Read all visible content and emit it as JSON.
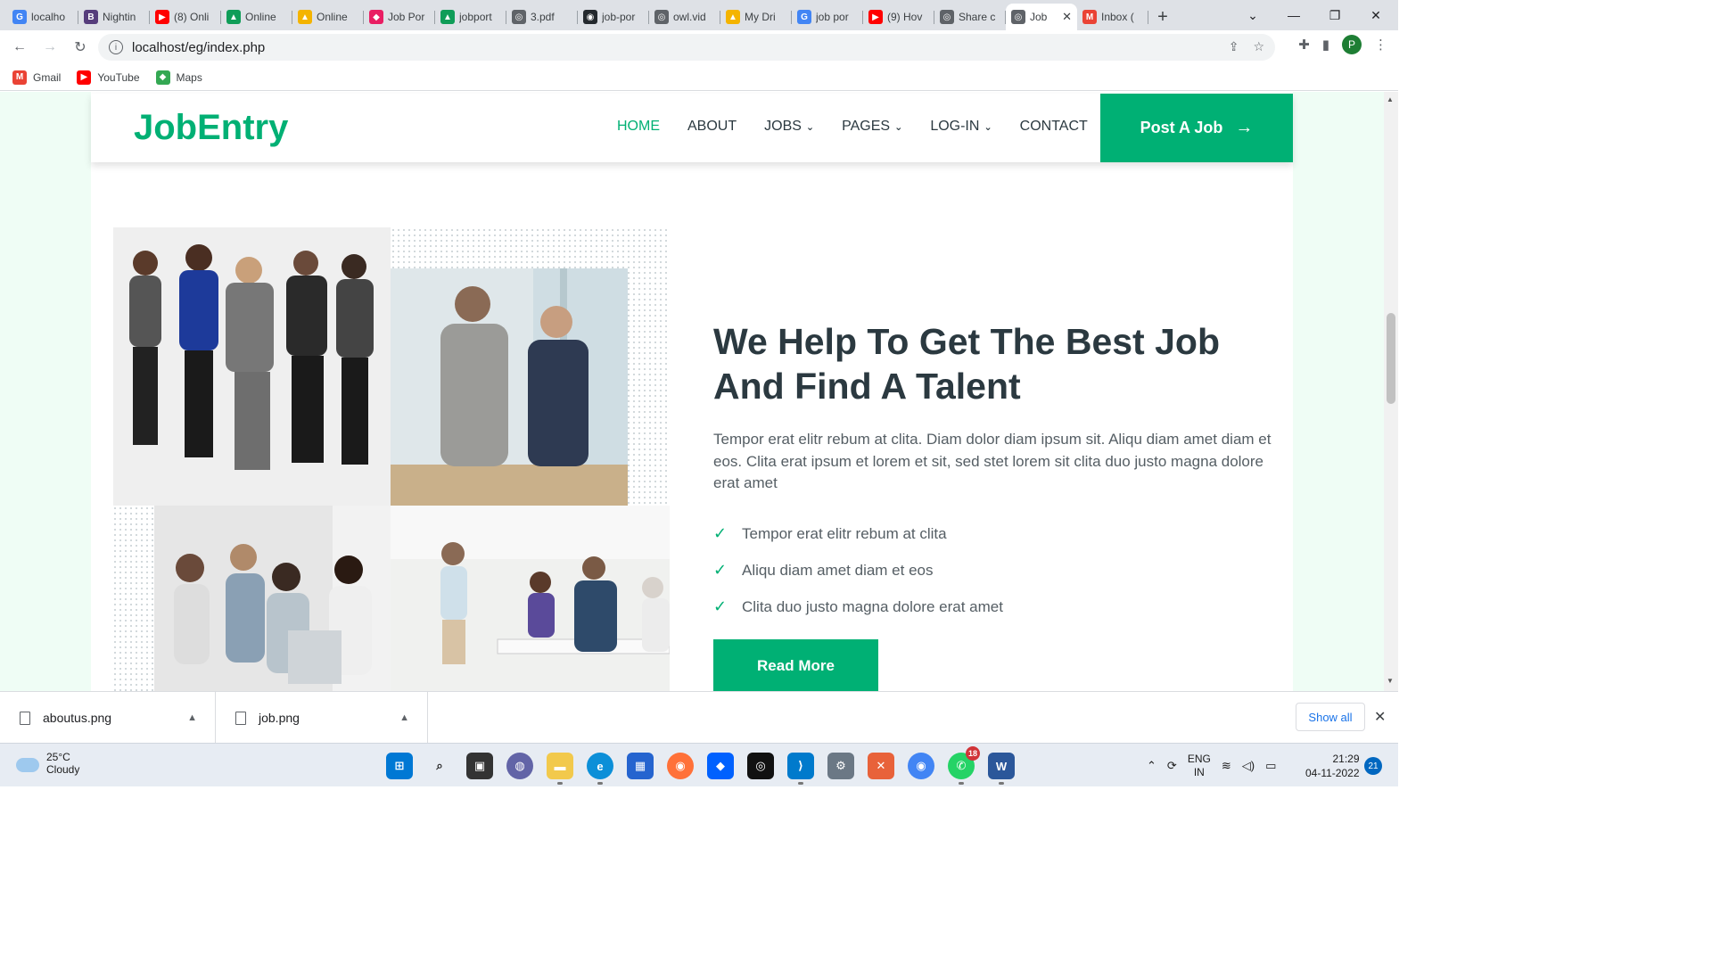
{
  "browser": {
    "tabs": [
      {
        "label": "localho",
        "favicon": "G",
        "color": "#4285f4"
      },
      {
        "label": "Nightin",
        "favicon": "B",
        "color": "#563d7c"
      },
      {
        "label": "(8) Onli",
        "favicon": "▶",
        "color": "#ff0000"
      },
      {
        "label": "Online",
        "favicon": "▲",
        "color": "#0f9d58"
      },
      {
        "label": "Online",
        "favicon": "▲",
        "color": "#f4b400"
      },
      {
        "label": "Job Por",
        "favicon": "◆",
        "color": "#e91e63"
      },
      {
        "label": "jobport",
        "favicon": "▲",
        "color": "#0f9d58"
      },
      {
        "label": "3.pdf",
        "favicon": "◎",
        "color": "#5f6368"
      },
      {
        "label": "job-por",
        "favicon": "◉",
        "color": "#24292e"
      },
      {
        "label": "owl.vid",
        "favicon": "◎",
        "color": "#5f6368"
      },
      {
        "label": "My Dri",
        "favicon": "▲",
        "color": "#f4b400"
      },
      {
        "label": "job por",
        "favicon": "G",
        "color": "#4285f4"
      },
      {
        "label": "(9) Hov",
        "favicon": "▶",
        "color": "#ff0000"
      },
      {
        "label": "Share c",
        "favicon": "◎",
        "color": "#5f6368"
      },
      {
        "label": "Job",
        "favicon": "◎",
        "color": "#5f6368",
        "active": true
      },
      {
        "label": "Inbox (",
        "favicon": "M",
        "color": "#ea4335"
      }
    ],
    "new_tab": "+",
    "window_controls": {
      "chevron": "⌄",
      "minimize": "—",
      "restore": "❐",
      "close": "✕"
    },
    "url": "localhost/eg/index.php",
    "profile_initial": "P",
    "bookmarks": [
      {
        "label": "Gmail",
        "icon": "M",
        "color": "#ea4335"
      },
      {
        "label": "YouTube",
        "icon": "▶",
        "color": "#ff0000"
      },
      {
        "label": "Maps",
        "icon": "◆",
        "color": "#34a853"
      }
    ]
  },
  "site": {
    "brand": "JobEntry",
    "nav": [
      {
        "label": "HOME",
        "active": true,
        "dropdown": false
      },
      {
        "label": "ABOUT",
        "active": false,
        "dropdown": false
      },
      {
        "label": "JOBS",
        "active": false,
        "dropdown": true
      },
      {
        "label": "PAGES",
        "active": false,
        "dropdown": true
      },
      {
        "label": "LOG-IN",
        "active": false,
        "dropdown": true
      },
      {
        "label": "CONTACT",
        "active": false,
        "dropdown": false
      }
    ],
    "post_job_label": "Post A Job",
    "accent_color": "#00b074",
    "about": {
      "headline": "We Help To Get The Best Job And Find A Talent",
      "paragraph": "Tempor erat elitr rebum at clita. Diam dolor diam ipsum sit. Aliqu diam amet diam et eos. Clita erat ipsum et lorem et sit, sed stet lorem sit clita duo justo magna dolore erat amet",
      "checklist": [
        "Tempor erat elitr rebum at clita",
        "Aliqu diam amet diam et eos",
        "Clita duo justo magna dolore erat amet"
      ],
      "read_more_label": "Read More"
    }
  },
  "downloads": {
    "items": [
      {
        "name": "aboutus.png"
      },
      {
        "name": "job.png"
      }
    ],
    "show_all": "Show all"
  },
  "taskbar": {
    "weather_temp": "25°C",
    "weather_desc": "Cloudy",
    "lang_top": "ENG",
    "lang_bottom": "IN",
    "time": "21:29",
    "date": "04-11-2022",
    "notifications": "21",
    "whatsapp_badge": "18"
  }
}
